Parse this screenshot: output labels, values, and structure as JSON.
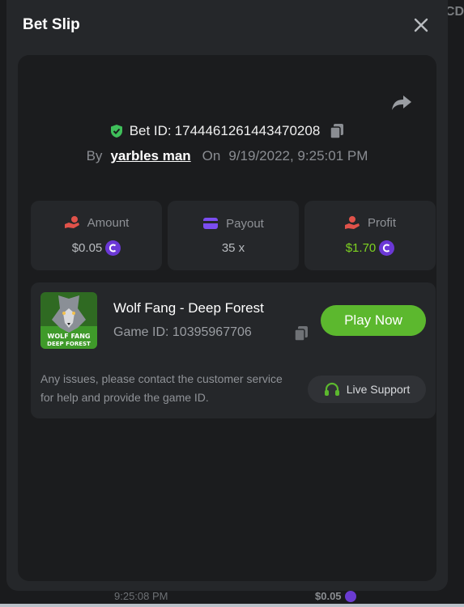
{
  "background": {
    "top_right_text": "CD",
    "bottom_time": "9:25:08 PM",
    "bottom_amount": "$0.05"
  },
  "modal": {
    "title": "Bet Slip"
  },
  "bet": {
    "id_label": "Bet ID:",
    "id_value": "1744461261443470208",
    "by_label": "By",
    "username": "yarbles man",
    "on_label": "On",
    "datetime": "9/19/2022, 9:25:01 PM"
  },
  "stats": [
    {
      "label": "Amount",
      "value": "$0.05",
      "has_coin": true,
      "icon": "hand-coins-icon"
    },
    {
      "label": "Payout",
      "value": "35 x",
      "has_coin": false,
      "icon": "card-icon"
    },
    {
      "label": "Profit",
      "value": "$1.70",
      "has_coin": true,
      "icon": "hand-profit-icon"
    }
  ],
  "game": {
    "name": "Wolf Fang - Deep Forest",
    "id_text": "Game ID: 10395967706",
    "thumb_line1": "WOLF FANG",
    "thumb_line2": "DEEP FOREST",
    "play_label": "Play Now"
  },
  "support": {
    "message": "Any issues, please contact the customer service for help and provide the game ID.",
    "button_label": "Live Support"
  },
  "colors": {
    "accent_green": "#5cb82e",
    "profit_green": "#7ed321",
    "coin_purple": "#6b38d6",
    "shield_green": "#3fbf5a",
    "icon_red": "#e0524a",
    "icon_purple": "#7b4df0"
  }
}
